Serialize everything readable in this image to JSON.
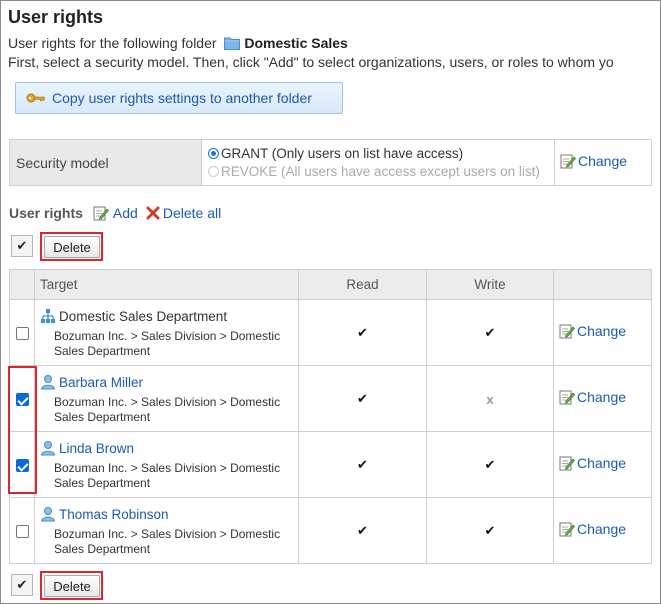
{
  "page": {
    "title": "User rights",
    "intro_prefix": "User rights for the following folder",
    "folder_name": "Domestic Sales",
    "instruction": "First, select a security model. Then, click \"Add\" to select organizations, users, or roles to whom yo",
    "copy_button": "Copy user rights settings to another folder"
  },
  "security": {
    "label": "Security model",
    "grant": "GRANT (Only users on list have access)",
    "revoke": "REVOKE (All users have access except users on list)",
    "selected": "GRANT",
    "change": "Change"
  },
  "rights": {
    "title": "User rights",
    "add": "Add",
    "delete_all": "Delete all",
    "select_all_mark": "✔",
    "delete_button": "Delete"
  },
  "table": {
    "headers": {
      "target": "Target",
      "read": "Read",
      "write": "Write"
    },
    "rows": [
      {
        "type": "department",
        "name": "Domestic Sales Department",
        "path": "Bozuman Inc. > Sales Division > Domestic Sales Department",
        "checked": false,
        "read": "✔",
        "write": "✔",
        "change": "Change"
      },
      {
        "type": "user",
        "name": "Barbara Miller",
        "path": "Bozuman Inc. > Sales Division > Domestic Sales Department",
        "checked": true,
        "read": "✔",
        "write": "x",
        "change": "Change"
      },
      {
        "type": "user",
        "name": "Linda Brown",
        "path": "Bozuman Inc. > Sales Division > Domestic Sales Department",
        "checked": true,
        "read": "✔",
        "write": "✔",
        "change": "Change"
      },
      {
        "type": "user",
        "name": "Thomas Robinson",
        "path": "Bozuman Inc. > Sales Division > Domestic Sales Department",
        "checked": false,
        "read": "✔",
        "write": "✔",
        "change": "Change"
      }
    ]
  },
  "colors": {
    "link": "#1a5bb5",
    "highlight": "#d9282f",
    "checkbox": "#0b6bd6"
  }
}
